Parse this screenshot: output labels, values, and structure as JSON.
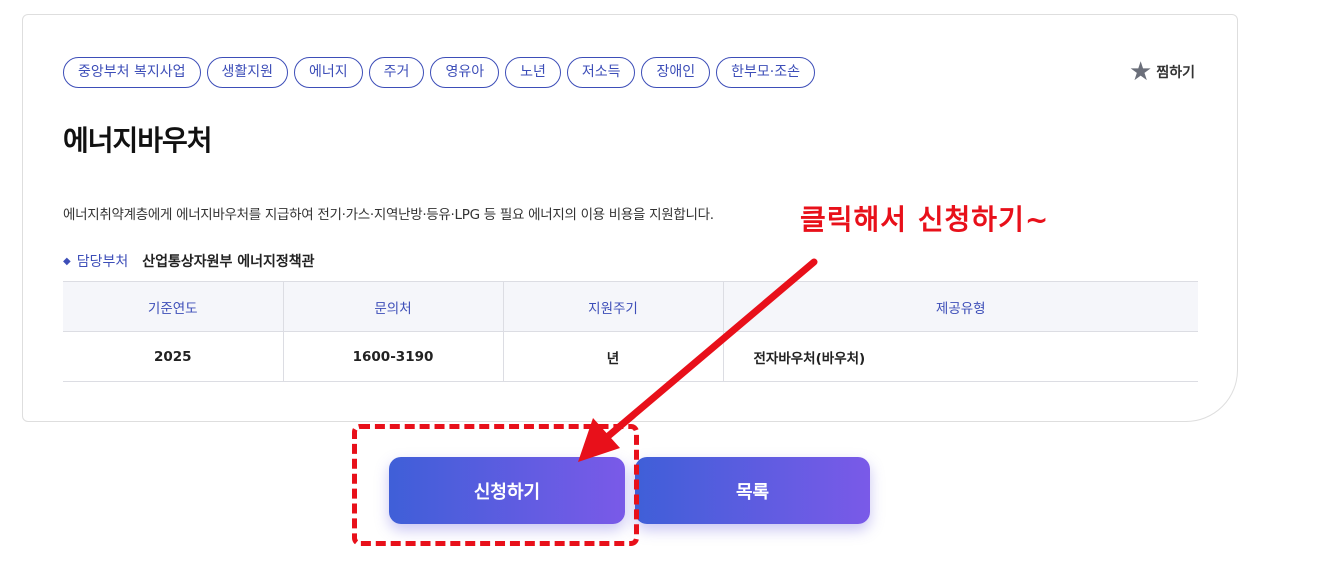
{
  "tags": [
    "중앙부처 복지사업",
    "생활지원",
    "에너지",
    "주거",
    "영유아",
    "노년",
    "저소득",
    "장애인",
    "한부모·조손"
  ],
  "favorite": {
    "icon": "star-icon",
    "label": "찜하기"
  },
  "title": "에너지바우처",
  "description": "에너지취약계층에게 에너지바우처를 지급하여 전기·가스·지역난방·등유·LPG 등 필요 에너지의 이용 비용을 지원합니다.",
  "department": {
    "label": "담당부처",
    "value": "산업통상자원부 에너지정책관"
  },
  "table": {
    "headers": [
      "기준연도",
      "문의처",
      "지원주기",
      "제공유형"
    ],
    "row": [
      "2025",
      "1600-3190",
      "년",
      "전자바우처(바우처)"
    ]
  },
  "buttons": {
    "apply": "신청하기",
    "list": "목록"
  },
  "annotation": {
    "text": "클릭해서 신청하기~",
    "color": "#e8101a"
  },
  "colors": {
    "accent": "#3d4eb8",
    "button_start": "#3f5fd8",
    "button_end": "#7a5ae8"
  }
}
